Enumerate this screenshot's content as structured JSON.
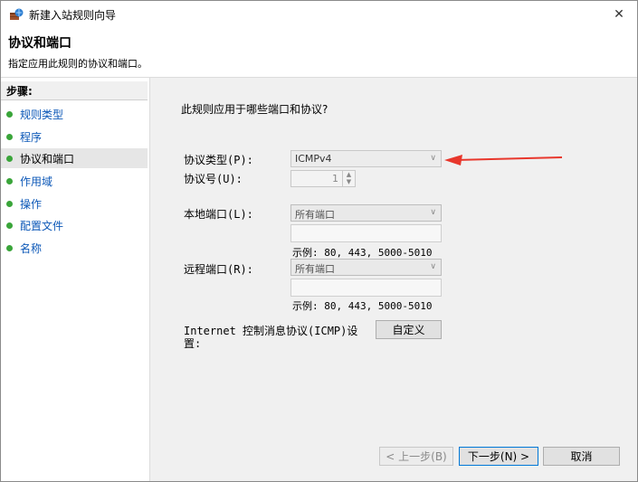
{
  "window": {
    "title": "新建入站规则向导",
    "close_glyph": "✕"
  },
  "header": {
    "title": "协议和端口",
    "subtitle": "指定应用此规则的协议和端口。"
  },
  "steps": {
    "heading": "步骤:",
    "items": [
      {
        "label": "规则类型"
      },
      {
        "label": "程序"
      },
      {
        "label": "协议和端口"
      },
      {
        "label": "作用域"
      },
      {
        "label": "操作"
      },
      {
        "label": "配置文件"
      },
      {
        "label": "名称"
      }
    ],
    "current_index": 2
  },
  "content": {
    "question": "此规则应用于哪些端口和协议?",
    "protocol_type": {
      "label": "协议类型(P):",
      "value": "ICMPv4"
    },
    "protocol_number": {
      "label": "协议号(U):",
      "value": "1"
    },
    "local_port": {
      "label": "本地端口(L):",
      "value": "所有端口",
      "example": "示例: 80, 443, 5000-5010"
    },
    "remote_port": {
      "label": "远程端口(R):",
      "value": "所有端口",
      "example": "示例: 80, 443, 5000-5010"
    },
    "icmp": {
      "label_line1": "Internet 控制消息协议(ICMP)设",
      "label_line2": "置:",
      "button": "自定义"
    }
  },
  "footer": {
    "back": "< 上一步(B)",
    "next": "下一步(N) >",
    "cancel": "取消"
  },
  "colors": {
    "accent": "#0078d7",
    "link": "#0b57b7",
    "step_dot": "#3aa53a",
    "annotation_arrow": "#e8372c"
  }
}
